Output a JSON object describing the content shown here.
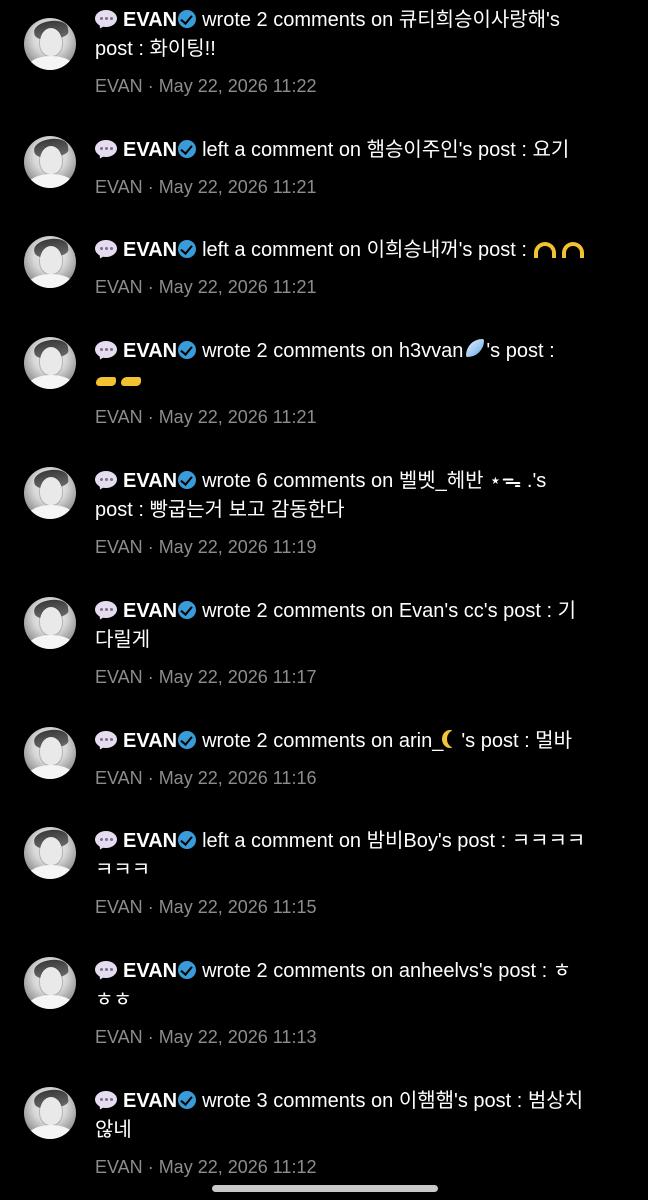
{
  "username": "EVAN",
  "notifications": [
    {
      "action": "wrote 2 comments on 큐티희승이사랑해's",
      "post_text": "post : 화이팅!!",
      "meta_user": "EVAN",
      "timestamp": "May 22, 2026 11:22"
    },
    {
      "action": "left a comment on 햄승이주인's post : 요기",
      "post_text": "",
      "meta_user": "EVAN",
      "timestamp": "May 22, 2026 11:21"
    },
    {
      "action": "left a comment on 이희승내꺼's post :",
      "post_text": "",
      "meta_user": "EVAN",
      "timestamp": "May 22, 2026 11:21"
    },
    {
      "action": "wrote 2 comments on h3vvan",
      "action_suffix": "'s post :",
      "post_text": "",
      "meta_user": "EVAN",
      "timestamp": "May 22, 2026 11:21"
    },
    {
      "action": "wrote 6 comments on 벨벳_헤반 ⋆ᯓ .'s",
      "post_text": "post : 빵굽는거 보고 감동한다",
      "meta_user": "EVAN",
      "timestamp": "May 22, 2026 11:19"
    },
    {
      "action": "wrote 2 comments on Evan's cc's post : 기",
      "post_text": "다릴게",
      "meta_user": "EVAN",
      "timestamp": "May 22, 2026 11:17"
    },
    {
      "action": "wrote 2 comments on arin_",
      "action_suffix": "'s post : 멀바",
      "post_text": "",
      "meta_user": "EVAN",
      "timestamp": "May 22, 2026 11:16"
    },
    {
      "action": "left a comment on 밤비Boy's post : ㅋㅋㅋㅋ",
      "post_text": "ㅋㅋㅋ",
      "meta_user": "EVAN",
      "timestamp": "May 22, 2026 11:15"
    },
    {
      "action": "wrote 2 comments on anheelvs's post : ㅎ",
      "post_text": "ㅎㅎ",
      "meta_user": "EVAN",
      "timestamp": "May 22, 2026 11:13"
    },
    {
      "action": "wrote 3 comments on 이햄햄's post : 범상치",
      "post_text": "않네",
      "meta_user": "EVAN",
      "timestamp": "May 22, 2026 11:12"
    }
  ],
  "meta_separator": "·",
  "colors": {
    "background": "#000000",
    "text": "#ffffff",
    "meta": "#8d8d8d",
    "verified": "#3a9bd9"
  },
  "icons": {
    "bubble": "speech-bubble-icon",
    "verified": "verified-badge-icon"
  }
}
